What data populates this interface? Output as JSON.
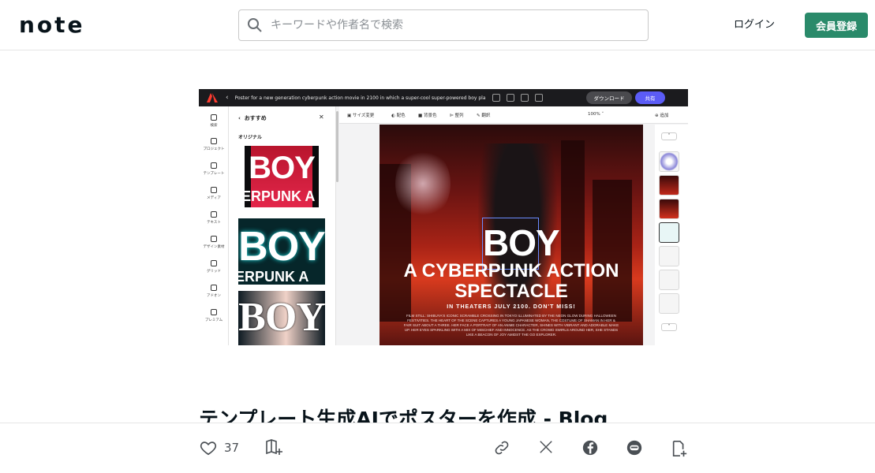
{
  "header": {
    "logo": "note",
    "search_placeholder": "キーワードや作者名で検索",
    "login": "ログイン",
    "signup": "会員登録"
  },
  "editor": {
    "doc_title": "Poster for a new generation cyberpunk action movie in 2100 in which a super-cool super-powered boy pla",
    "download": "ダウンロード",
    "share": "共有",
    "rail": [
      "検索",
      "プロジェクト",
      "テンプレート",
      "メディア",
      "テキスト",
      "デザイン素材",
      "グリッド",
      "アドオン",
      "プレミアム"
    ],
    "panel_title": "おすすめ",
    "panel_close": "✕",
    "panel_section": "オリジナル",
    "tiles": [
      {
        "big": "BOY",
        "small": "ERPUNK A"
      },
      {
        "big": "BOY",
        "small": "ERPUNK A"
      },
      {
        "big": "BOY",
        "small": ""
      }
    ],
    "toolbar": [
      "サイズ変更",
      "配色",
      "背景色",
      "整列",
      "翻訳"
    ],
    "zoom": "100%",
    "add": "追加",
    "poster": {
      "title": "BOY",
      "line1": "A CYBERPUNK ACTION",
      "line2": "SPECTACLE",
      "line3": "IN THEATERS JULY 2100. DON'T MISS!",
      "body": "FILM STILL: SHIBUYA'S ICONIC SCRAMBLE CROSSING IN TOKYO ILLUMINATED BY THE NEON GLOW DURING HALLOWEEN FESTIVITIES. THE HEART OF THE SCENE CAPTURES A YOUNG JAPANESE WOMAN, THE COSTUME OF SHAMAN IN HER & FAIR SUIT ABOUT A THREE. HER FACE A PORTRAIT OF AN ANIME CHARACTER, SHINES WITH VIBRANT AND ADORABLE MAKE UP. HER EYES SPARKLING WITH A MIX OF MISCHIEF AND INNOCENCE. AS THE CROWD SWIRLS AROUND HER, SHE STANDS LIKE A BEACON OF JOY AMIDST THE GO EXPLORER."
    }
  },
  "article": {
    "title": "テンプレート生成AIでポスターを作成 - Blog"
  },
  "actions": {
    "like_count": "37"
  }
}
